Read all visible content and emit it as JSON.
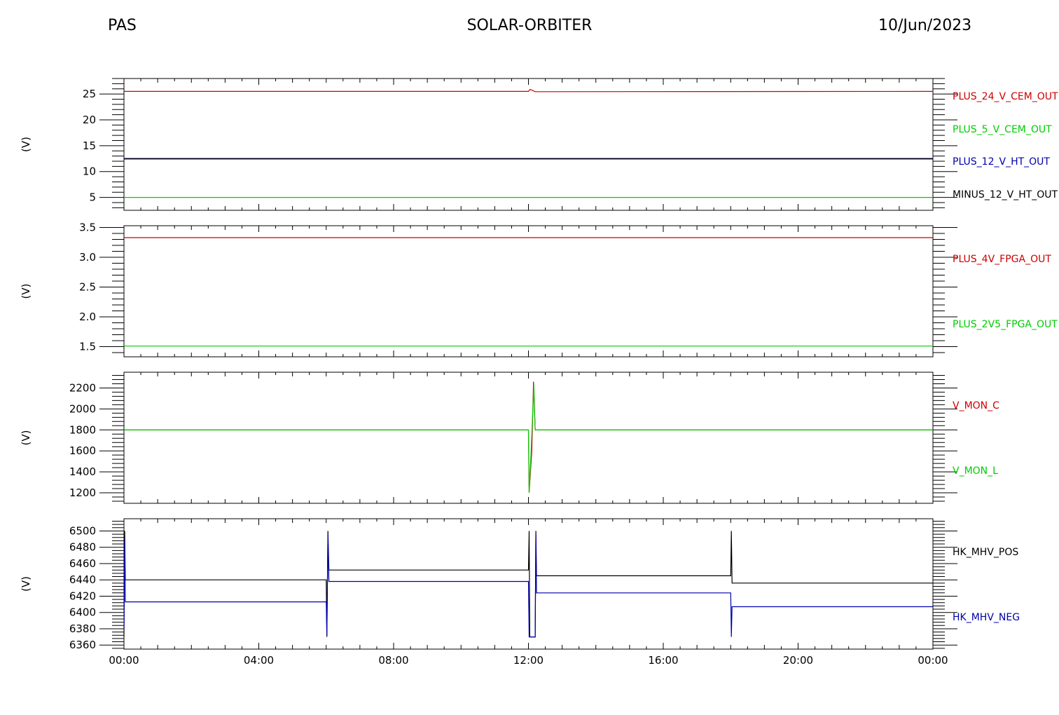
{
  "header": {
    "left": "PAS",
    "center": "SOLAR-ORBITER",
    "right": "10/Jun/2023"
  },
  "chart_data": [
    {
      "type": "line",
      "ylabel": "(V)",
      "ylim": [
        2.5,
        28
      ],
      "yticks": [
        5,
        10,
        15,
        20,
        25
      ],
      "xlim": [
        0,
        24
      ],
      "series": [
        {
          "name": "PLUS_24_V_CEM_OUT",
          "color": "#cc0000",
          "points": [
            [
              0,
              25.5
            ],
            [
              12.0,
              25.5
            ],
            [
              12.05,
              25.9
            ],
            [
              12.2,
              25.45
            ],
            [
              24,
              25.5
            ]
          ]
        },
        {
          "name": "PLUS_5_V_CEM_OUT",
          "color": "#00cc00",
          "points": [
            [
              0,
              5.0
            ],
            [
              24,
              5.0
            ]
          ]
        },
        {
          "name": "PLUS_12_V_HT_OUT",
          "color": "#0000aa",
          "points": [
            [
              0,
              12.5
            ],
            [
              24,
              12.5
            ]
          ]
        },
        {
          "name": "MINUS_12_V_HT_OUT",
          "color": "#000000",
          "points": [
            [
              0,
              12.45
            ],
            [
              24,
              12.45
            ]
          ]
        }
      ]
    },
    {
      "type": "line",
      "ylabel": "(V)",
      "ylim": [
        1.33,
        3.53
      ],
      "yticks": [
        1.5,
        2.0,
        2.5,
        3.0,
        3.5
      ],
      "xlim": [
        0,
        24
      ],
      "series": [
        {
          "name": "PLUS_4V_FPGA_OUT",
          "color": "#cc0000",
          "points": [
            [
              0,
              3.33
            ],
            [
              24,
              3.33
            ]
          ]
        },
        {
          "name": "PLUS_2V5_FPGA_OUT",
          "color": "#00cc00",
          "points": [
            [
              0,
              1.51
            ],
            [
              24,
              1.51
            ]
          ]
        }
      ]
    },
    {
      "type": "line",
      "ylabel": "(V)",
      "ylim": [
        1100,
        2350
      ],
      "yticks": [
        1200,
        1400,
        1600,
        1800,
        2000,
        2200
      ],
      "xlim": [
        0,
        24
      ],
      "series": [
        {
          "name": "V_MON_C",
          "color": "#cc0000",
          "points": [
            [
              0,
              1800
            ],
            [
              12.0,
              1800
            ],
            [
              12.02,
              1200
            ],
            [
              12.1,
              1600
            ],
            [
              12.15,
              2260
            ],
            [
              12.2,
              1800
            ],
            [
              24,
              1800
            ]
          ]
        },
        {
          "name": "V_MON_L",
          "color": "#00cc00",
          "points": [
            [
              0,
              1800
            ],
            [
              12.0,
              1800
            ],
            [
              12.02,
              1200
            ],
            [
              12.08,
              1600
            ],
            [
              12.12,
              1920
            ],
            [
              12.16,
              2230
            ],
            [
              12.2,
              1800
            ],
            [
              24,
              1800
            ]
          ]
        }
      ]
    },
    {
      "type": "line",
      "ylabel": "(V)",
      "ylim": [
        6355,
        6515
      ],
      "yticks": [
        6360,
        6380,
        6400,
        6420,
        6440,
        6460,
        6480,
        6500
      ],
      "xlim": [
        0,
        24
      ],
      "series": [
        {
          "name": "HK_MHV_POS",
          "color": "#000000",
          "points": [
            [
              0,
              6370
            ],
            [
              0.02,
              6500
            ],
            [
              0.04,
              6440
            ],
            [
              6.0,
              6440
            ],
            [
              6.02,
              6370
            ],
            [
              6.05,
              6500
            ],
            [
              6.08,
              6452
            ],
            [
              12.0,
              6452
            ],
            [
              12.02,
              6500
            ],
            [
              12.04,
              6370
            ],
            [
              12.2,
              6370
            ],
            [
              12.22,
              6500
            ],
            [
              12.24,
              6445
            ],
            [
              18.0,
              6445
            ],
            [
              18.02,
              6500
            ],
            [
              18.04,
              6436
            ],
            [
              24,
              6436
            ]
          ]
        },
        {
          "name": "HK_MHV_NEG",
          "color": "#0000aa",
          "points": [
            [
              0,
              6380
            ],
            [
              0.02,
              6490
            ],
            [
              0.04,
              6413
            ],
            [
              6.0,
              6413
            ],
            [
              6.02,
              6372
            ],
            [
              6.05,
              6495
            ],
            [
              6.08,
              6438
            ],
            [
              12.0,
              6438
            ],
            [
              12.02,
              6370
            ],
            [
              12.2,
              6370
            ],
            [
              12.22,
              6495
            ],
            [
              12.24,
              6424
            ],
            [
              18.0,
              6424
            ],
            [
              18.02,
              6370
            ],
            [
              18.04,
              6407
            ],
            [
              24,
              6407
            ]
          ]
        }
      ]
    }
  ],
  "x_axis": {
    "tick_labels": [
      "00:00",
      "04:00",
      "08:00",
      "12:00",
      "16:00",
      "20:00",
      "00:00"
    ],
    "tick_hours": [
      0,
      4,
      8,
      12,
      16,
      20,
      24
    ]
  }
}
